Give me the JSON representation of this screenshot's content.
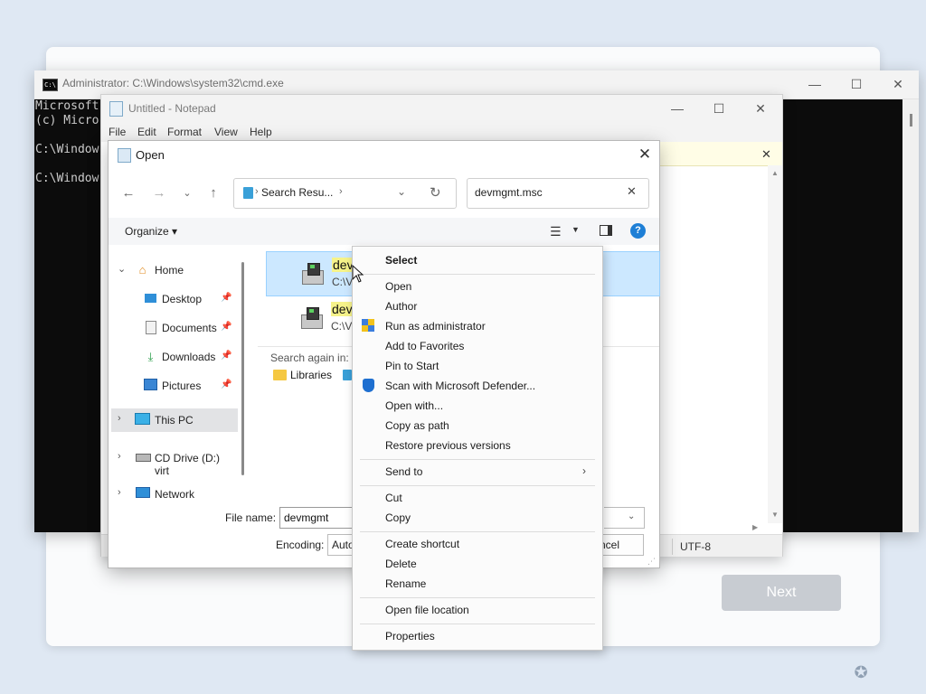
{
  "setup": {
    "next_label": "Next"
  },
  "cmd": {
    "title": "Administrator: C:\\Windows\\system32\\cmd.exe",
    "icon": "cmd-icon",
    "lines": [
      "Microsoft",
      "(c) Micro",
      "",
      "C:\\Window",
      "",
      "C:\\Window"
    ]
  },
  "notepad": {
    "title": "Untitled - Notepad",
    "menu": [
      "File",
      "Edit",
      "Format",
      "View",
      "Help"
    ],
    "encoding": "UTF-8"
  },
  "dialog": {
    "title": "Open",
    "address": "Search Resu...",
    "search_value": "devmgmt.msc",
    "organize_label": "Organize",
    "nav": [
      {
        "label": "Home",
        "icon": "home-icon"
      },
      {
        "label": "Desktop",
        "icon": "desktop-icon"
      },
      {
        "label": "Documents",
        "icon": "documents-icon"
      },
      {
        "label": "Downloads",
        "icon": "downloads-icon"
      },
      {
        "label": "Pictures",
        "icon": "pictures-icon"
      },
      {
        "label": "This PC",
        "icon": "this-pc-icon"
      },
      {
        "label": "CD Drive (D:) virt",
        "icon": "cd-drive-icon"
      },
      {
        "label": "Network",
        "icon": "network-icon"
      }
    ],
    "files": [
      {
        "name": "dev",
        "path": "C:\\V"
      },
      {
        "name": "dev",
        "path": "C:\\V"
      }
    ],
    "search_again_label": "Search again in:",
    "libraries_label": "Libraries",
    "filename_label": "File name:",
    "filename_value": "devmgmt",
    "encoding_label": "Encoding:",
    "encoding_value": "Auto",
    "cancel_label": "ncel"
  },
  "context_menu": {
    "items": [
      {
        "label": "Select",
        "bold": true
      },
      {
        "label": "Open"
      },
      {
        "label": "Author"
      },
      {
        "label": "Run as administrator",
        "icon": "uac-shield-icon"
      },
      {
        "label": "Add to Favorites"
      },
      {
        "label": "Pin to Start"
      },
      {
        "label": "Scan with Microsoft Defender...",
        "icon": "defender-icon"
      },
      {
        "label": "Open with..."
      },
      {
        "label": "Copy as path"
      },
      {
        "label": "Restore previous versions"
      },
      {
        "label": "Send to",
        "submenu": true
      },
      {
        "label": "Cut"
      },
      {
        "label": "Copy"
      },
      {
        "label": "Create shortcut"
      },
      {
        "label": "Delete"
      },
      {
        "label": "Rename"
      },
      {
        "label": "Open file location"
      },
      {
        "label": "Properties"
      }
    ]
  },
  "colors": {
    "selection": "#cce8ff",
    "highlight": "#f6f38a",
    "accent": "#1e7fd6"
  }
}
